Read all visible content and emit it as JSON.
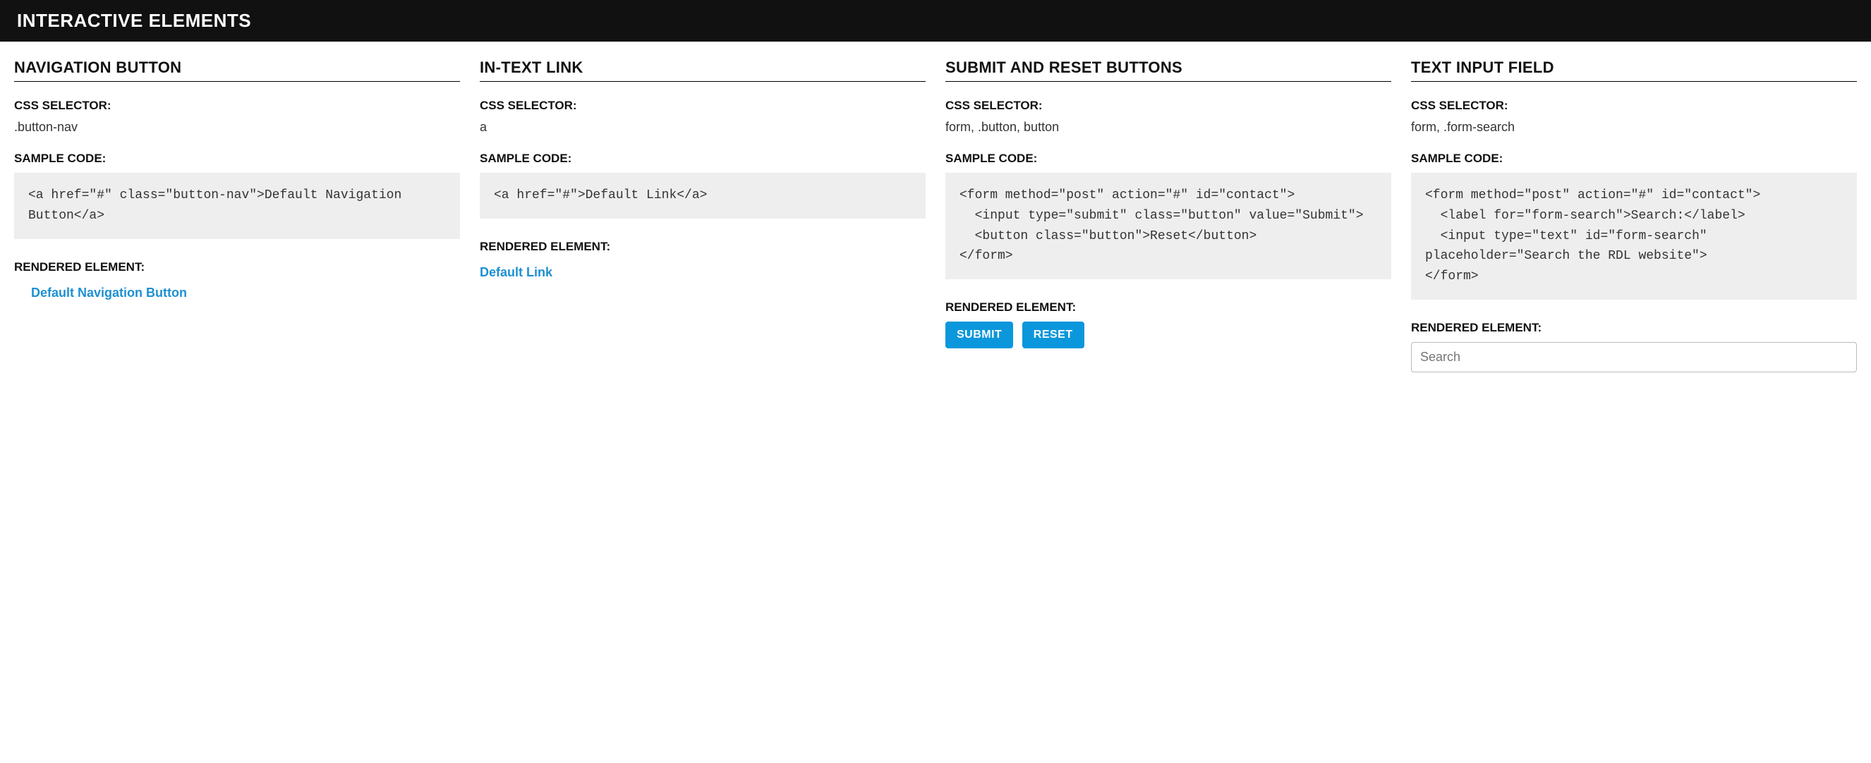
{
  "header": "INTERACTIVE ELEMENTS",
  "labels": {
    "css_selector": "CSS SELECTOR:",
    "sample_code": "SAMPLE CODE:",
    "rendered": "RENDERED ELEMENT:"
  },
  "columns": [
    {
      "title": "NAVIGATION BUTTON",
      "selector": ".button-nav",
      "code": "<a href=\"#\" class=\"button-nav\">Default Navigation Button</a>",
      "render_type": "nav-link",
      "render_text": "Default Navigation Button"
    },
    {
      "title": "IN-TEXT LINK",
      "selector": "a",
      "code": "<a href=\"#\">Default Link</a>",
      "render_type": "plain-link",
      "render_text": "Default Link"
    },
    {
      "title": "SUBMIT AND RESET BUTTONS",
      "selector": "form, .button, button",
      "code": "<form method=\"post\" action=\"#\" id=\"contact\">\n  <input type=\"submit\" class=\"button\" value=\"Submit\">\n  <button class=\"button\">Reset</button>\n</form>",
      "render_type": "buttons",
      "button1": "SUBMIT",
      "button2": "RESET"
    },
    {
      "title": "TEXT INPUT FIELD",
      "selector": "form, .form-search",
      "code": "<form method=\"post\" action=\"#\" id=\"contact\">\n  <label for=\"form-search\">Search:</label>\n  <input type=\"text\" id=\"form-search\" placeholder=\"Search the RDL website\">\n</form>",
      "render_type": "search",
      "placeholder": "Search"
    }
  ]
}
